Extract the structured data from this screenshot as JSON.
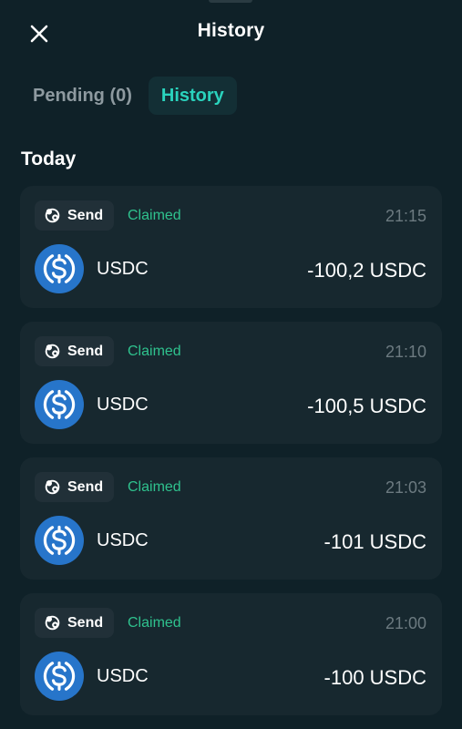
{
  "header": {
    "title": "History",
    "close_icon": "close-icon"
  },
  "tabs": [
    {
      "label": "Pending (0)",
      "active": false
    },
    {
      "label": "History",
      "active": true
    }
  ],
  "section": {
    "title": "Today"
  },
  "colors": {
    "background": "#0f2128",
    "card": "#17282f",
    "accent": "#2ad3bd",
    "claimed": "#2fc28e",
    "usdc": "#2775ca"
  },
  "transactions": [
    {
      "type": "Send",
      "type_icon": "gift-send-icon",
      "status": "Claimed",
      "time": "21:15",
      "asset": "USDC",
      "asset_icon": "usdc-icon",
      "amount": "-100,2 USDC"
    },
    {
      "type": "Send",
      "type_icon": "gift-send-icon",
      "status": "Claimed",
      "time": "21:10",
      "asset": "USDC",
      "asset_icon": "usdc-icon",
      "amount": "-100,5 USDC"
    },
    {
      "type": "Send",
      "type_icon": "gift-send-icon",
      "status": "Claimed",
      "time": "21:03",
      "asset": "USDC",
      "asset_icon": "usdc-icon",
      "amount": "-101 USDC"
    },
    {
      "type": "Send",
      "type_icon": "gift-send-icon",
      "status": "Claimed",
      "time": "21:00",
      "asset": "USDC",
      "asset_icon": "usdc-icon",
      "amount": "-100 USDC"
    }
  ]
}
